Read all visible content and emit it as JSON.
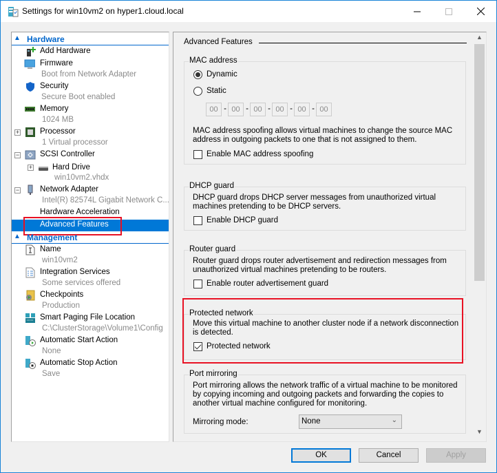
{
  "window": {
    "title": "Settings for win10vm2 on hyper1.cloud.local",
    "controls": {
      "minimize": "—",
      "maximize": "☐",
      "close": "✕"
    }
  },
  "tree": {
    "hardware_header": "Hardware",
    "management_header": "Management",
    "hardware": [
      {
        "label": "Add Hardware",
        "sub": null,
        "icon": "add-hardware-icon"
      },
      {
        "label": "Firmware",
        "sub": "Boot from Network Adapter",
        "icon": "firmware-icon"
      },
      {
        "label": "Security",
        "sub": "Secure Boot enabled",
        "icon": "shield-icon"
      },
      {
        "label": "Memory",
        "sub": "1024 MB",
        "icon": "memory-icon"
      },
      {
        "label": "Processor",
        "sub": "1 Virtual processor",
        "icon": "processor-icon",
        "expander": "+"
      },
      {
        "label": "SCSI Controller",
        "sub": null,
        "icon": "scsi-controller-icon",
        "expander": "−"
      },
      {
        "label": "Hard Drive",
        "sub": "win10vm2.vhdx",
        "icon": "hard-drive-icon",
        "expander": "+"
      },
      {
        "label": "Network Adapter",
        "sub": "Intel(R) 82574L Gigabit Network C...",
        "icon": "network-adapter-icon",
        "expander": "−"
      },
      {
        "label": "Hardware Acceleration",
        "sub": null
      },
      {
        "label": "Advanced Features",
        "sub": null,
        "selected": true
      }
    ],
    "management": [
      {
        "label": "Name",
        "sub": "win10vm2",
        "icon": "name-icon"
      },
      {
        "label": "Integration Services",
        "sub": "Some services offered",
        "icon": "integration-services-icon"
      },
      {
        "label": "Checkpoints",
        "sub": "Production",
        "icon": "checkpoints-icon"
      },
      {
        "label": "Smart Paging File Location",
        "sub": "C:\\ClusterStorage\\Volume1\\Config",
        "icon": "smart-paging-icon"
      },
      {
        "label": "Automatic Start Action",
        "sub": "None",
        "icon": "automatic-start-icon"
      },
      {
        "label": "Automatic Stop Action",
        "sub": "Save",
        "icon": "automatic-stop-icon"
      }
    ]
  },
  "panel": {
    "title": "Advanced Features",
    "mac": {
      "title": "MAC address",
      "dynamic_label": "Dynamic",
      "static_label": "Static",
      "selected": "Dynamic",
      "octets": [
        "00",
        "00",
        "00",
        "00",
        "00",
        "00"
      ],
      "separator": "-",
      "spoof_desc": "MAC address spoofing allows virtual machines to change the source MAC address in outgoing packets to one that is not assigned to them.",
      "spoof_label": "Enable MAC address spoofing",
      "spoof_checked": false
    },
    "dhcp": {
      "title": "DHCP guard",
      "desc": "DHCP guard drops DHCP server messages from unauthorized virtual machines pretending to be DHCP servers.",
      "label": "Enable DHCP guard",
      "checked": false
    },
    "router": {
      "title": "Router guard",
      "desc": "Router guard drops router advertisement and redirection messages from unauthorized virtual machines pretending to be routers.",
      "label": "Enable router advertisement guard",
      "checked": false
    },
    "protected": {
      "title": "Protected network",
      "desc": "Move this virtual machine to another cluster node if a network disconnection is detected.",
      "label": "Protected network",
      "checked": true
    },
    "mirroring": {
      "title": "Port mirroring",
      "desc": "Port mirroring allows the network traffic of a virtual machine to be monitored by copying incoming and outgoing packets and forwarding the copies to another virtual machine configured for monitoring.",
      "mode_label": "Mirroring mode:",
      "mode_value": "None"
    }
  },
  "buttons": {
    "ok": "OK",
    "cancel": "Cancel",
    "apply": "Apply"
  },
  "colors": {
    "accent": "#0078d7",
    "highlight_box": "#e81123",
    "header_blue": "#0066cc"
  }
}
